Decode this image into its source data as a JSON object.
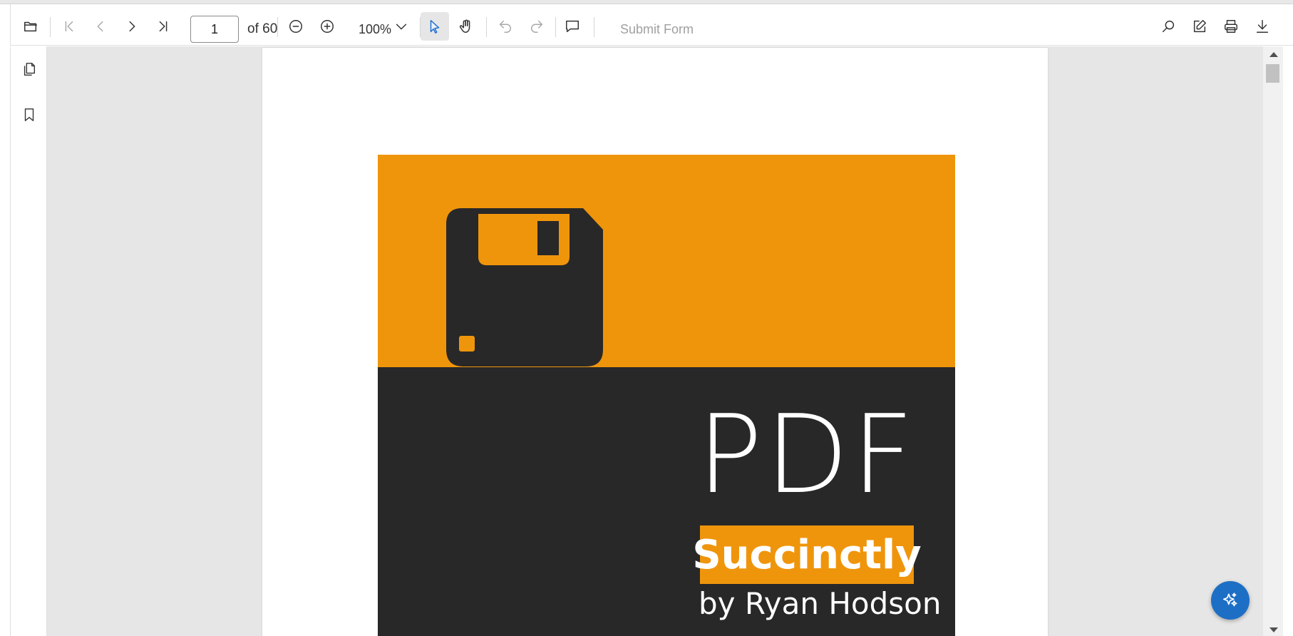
{
  "toolbar": {
    "open_icon": "folder-open-icon",
    "first_page_icon": "first-page-icon",
    "prev_page_icon": "chevron-left-icon",
    "next_page_icon": "chevron-right-icon",
    "last_page_icon": "last-page-icon",
    "current_page": "1",
    "page_count_label": "of 60",
    "zoom_out_icon": "zoom-out-icon",
    "zoom_in_icon": "zoom-in-icon",
    "zoom_level": "100%",
    "zoom_dropdown_icon": "chevron-down-icon",
    "selection_tool_icon": "cursor-icon",
    "pan_tool_icon": "hand-icon",
    "undo_icon": "undo-icon",
    "redo_icon": "redo-icon",
    "comment_icon": "comment-icon",
    "submit_form_label": "Submit Form",
    "search_icon": "search-icon",
    "edit_icon": "edit-icon",
    "print_icon": "print-icon",
    "download_icon": "download-icon"
  },
  "sidebar": {
    "items": [
      {
        "icon": "page-thumbnails-icon"
      },
      {
        "icon": "bookmark-icon"
      }
    ]
  },
  "document": {
    "cover_title": "PDF",
    "cover_subtitle": "Succinctly",
    "cover_author": "by Ryan Hodson",
    "cover_icon": "floppy-disk-icon",
    "colors": {
      "orange": "#ef950c",
      "dark": "#282828"
    }
  },
  "ai_assist": {
    "icon": "sparkle-icon",
    "color": "#1d6fc5"
  }
}
